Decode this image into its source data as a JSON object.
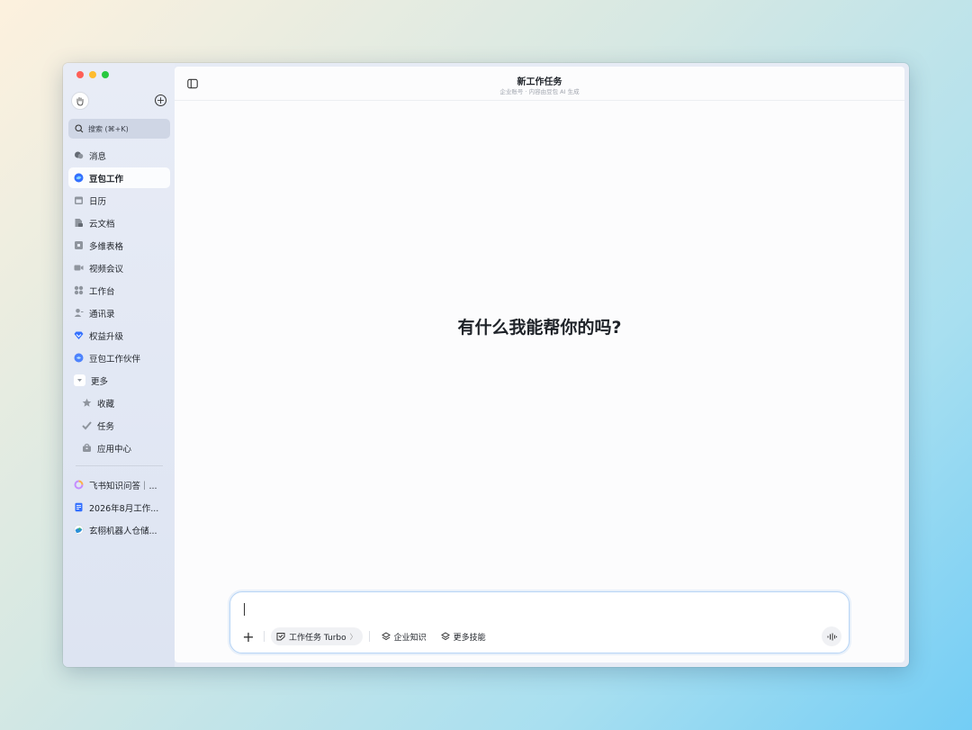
{
  "sidebar": {
    "search_label": "搜索 (⌘+K)",
    "nav_items": [
      {
        "label": "消息",
        "icon": "chat-icon"
      },
      {
        "label": "豆包工作",
        "icon": "doubao-work-icon",
        "active": true
      },
      {
        "label": "日历",
        "icon": "calendar-icon"
      },
      {
        "label": "云文档",
        "icon": "cloud-doc-icon"
      },
      {
        "label": "多维表格",
        "icon": "base-table-icon"
      },
      {
        "label": "视频会议",
        "icon": "video-icon"
      },
      {
        "label": "工作台",
        "icon": "workplace-icon"
      },
      {
        "label": "通讯录",
        "icon": "contacts-icon"
      },
      {
        "label": "权益升级",
        "icon": "diamond-icon"
      },
      {
        "label": "豆包工作伙伴",
        "icon": "partner-icon"
      },
      {
        "label": "更多",
        "icon": "chevron-down-icon"
      }
    ],
    "sub_items": [
      {
        "label": "收藏",
        "icon": "star-icon"
      },
      {
        "label": "任务",
        "icon": "check-icon"
      },
      {
        "label": "应用中心",
        "icon": "bag-icon"
      }
    ],
    "recent_items": [
      {
        "label": "飞书知识问答｜...",
        "icon": "ring-icon"
      },
      {
        "label": "2026年8月工作...",
        "icon": "doc-icon"
      },
      {
        "label": "玄栩机器人仓储...",
        "icon": "globe-icon"
      }
    ]
  },
  "header": {
    "title": "新工作任务",
    "subtitle": "企业账号 · 内容由豆包 AI 生成"
  },
  "main": {
    "hero_text": "有什么我能帮你的吗?"
  },
  "composer": {
    "chips": [
      {
        "label": "工作任务 Turbo",
        "icon": "task-icon",
        "arrow": "〉"
      },
      {
        "label": "企业知识",
        "icon": "layers-icon"
      },
      {
        "label": "更多技能",
        "icon": "layers-icon"
      }
    ]
  },
  "colors": {
    "accent": "#3370ff",
    "traffic_red": "#fe5f57",
    "traffic_yellow": "#febc2e",
    "traffic_green": "#28c840"
  }
}
